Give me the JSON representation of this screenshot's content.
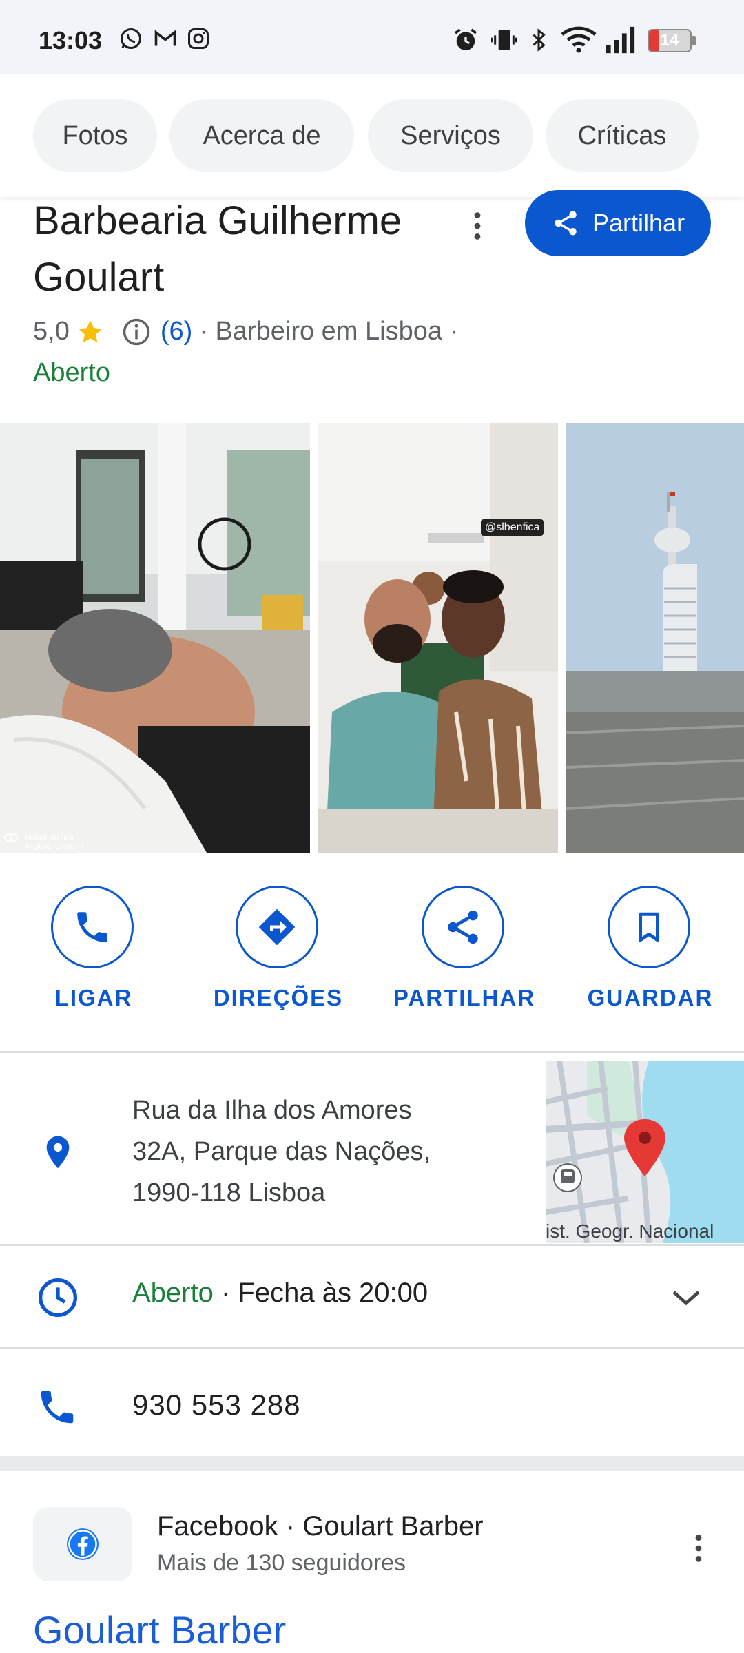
{
  "status_bar": {
    "time": "13:03",
    "battery": "14",
    "left_icons": [
      "whatsapp-icon",
      "gmail-icon",
      "instagram-icon"
    ],
    "right_icons": [
      "alarm-icon",
      "vibrate-icon",
      "bluetooth-icon",
      "wifi-icon",
      "signal-icon",
      "battery-icon"
    ]
  },
  "tabs": [
    "Fotos",
    "Acerca de",
    "Serviços",
    "Críticas"
  ],
  "business": {
    "name": "Barbearia Guilherme Goulart",
    "share_label": "Partilhar",
    "rating": "5,0",
    "reviews": "(6)",
    "category": "· Barbeiro em Lisboa ·",
    "status": "Aberto"
  },
  "actions": [
    {
      "label": "LIGAR",
      "icon": "phone-icon"
    },
    {
      "label": "DIREÇÕES",
      "icon": "directions-icon"
    },
    {
      "label": "PARTILHAR",
      "icon": "share-icon"
    },
    {
      "label": "GUARDAR",
      "icon": "bookmark-icon"
    }
  ],
  "address": {
    "line1": "Rua da Ilha dos Amores",
    "line2": "32A, Parque das Nações,",
    "line3": "1990-118 Lisboa",
    "map_label": "ist. Geogr. Nacional"
  },
  "hours": {
    "status": "Aberto",
    "detail": " · Fecha às 20:00"
  },
  "phone": "930 553 288",
  "facebook": {
    "title": "Facebook · Goulart Barber",
    "subtitle": "Mais de 130 seguidores",
    "link_title": "Goulart Barber"
  },
  "photos": {
    "photo1_watermark_a": "REDMI NOTE 9",
    "photo1_watermark_b": "AI QUAD CAMERA",
    "photo2_sign": "@slbenfica"
  },
  "colors": {
    "accent": "#0b57d0",
    "open_green": "#188038",
    "star": "#fbbc04"
  }
}
